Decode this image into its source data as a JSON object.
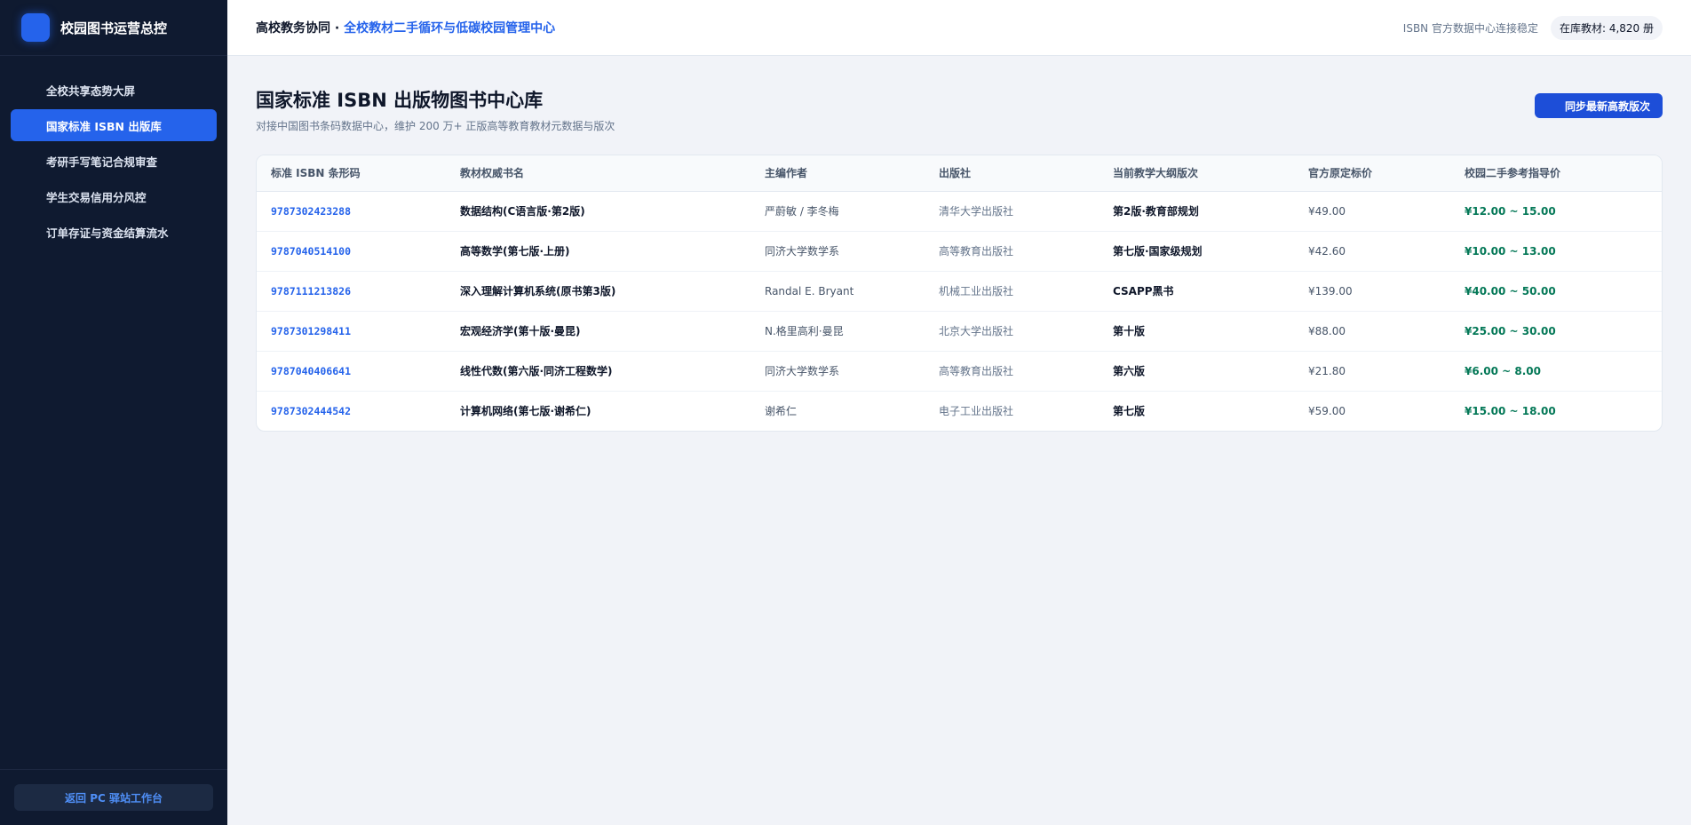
{
  "sidebar": {
    "brand": "校园图书运营总控",
    "items": [
      {
        "label": "全校共享态势大屏"
      },
      {
        "label": "国家标准 ISBN 出版库"
      },
      {
        "label": "考研手写笔记合规审查"
      },
      {
        "label": "学生交易信用分风控"
      },
      {
        "label": "订单存证与资金结算流水"
      }
    ],
    "back_label": "返回 PC 驿站工作台"
  },
  "topbar": {
    "prefix": "高校教务协同 · ",
    "title": "全校教材二手循环与低碳校园管理中心",
    "status": "ISBN 官方数据中心连接稳定",
    "stock": "在库教材: 4,820 册"
  },
  "page": {
    "title": "国家标准 ISBN 出版物图书中心库",
    "subtitle": "对接中国图书条码数据中心，维护 200 万+ 正版高等教育教材元数据与版次",
    "sync_label": "同步最新高教版次"
  },
  "table": {
    "headers": [
      "标准 ISBN 条形码",
      "教材权威书名",
      "主编作者",
      "出版社",
      "当前教学大纲版次",
      "官方原定标价",
      "校园二手参考指导价"
    ],
    "rows": [
      {
        "isbn": "9787302423288",
        "title": "数据结构(C语言版·第2版)",
        "author": "严蔚敏 / 李冬梅",
        "publisher": "清华大学出版社",
        "edition": "第2版·教育部规划",
        "price": "¥49.00",
        "guide": "¥12.00 ~ 15.00"
      },
      {
        "isbn": "9787040514100",
        "title": "高等数学(第七版·上册)",
        "author": "同济大学数学系",
        "publisher": "高等教育出版社",
        "edition": "第七版·国家级规划",
        "price": "¥42.60",
        "guide": "¥10.00 ~ 13.00"
      },
      {
        "isbn": "9787111213826",
        "title": "深入理解计算机系统(原书第3版)",
        "author": "Randal E. Bryant",
        "publisher": "机械工业出版社",
        "edition": "CSAPP黑书",
        "price": "¥139.00",
        "guide": "¥40.00 ~ 50.00"
      },
      {
        "isbn": "9787301298411",
        "title": "宏观经济学(第十版·曼昆)",
        "author": "N.格里高利·曼昆",
        "publisher": "北京大学出版社",
        "edition": "第十版",
        "price": "¥88.00",
        "guide": "¥25.00 ~ 30.00"
      },
      {
        "isbn": "9787040406641",
        "title": "线性代数(第六版·同济工程数学)",
        "author": "同济大学数学系",
        "publisher": "高等教育出版社",
        "edition": "第六版",
        "price": "¥21.80",
        "guide": "¥6.00 ~ 8.00"
      },
      {
        "isbn": "9787302444542",
        "title": "计算机网络(第七版·谢希仁)",
        "author": "谢希仁",
        "publisher": "电子工业出版社",
        "edition": "第七版",
        "price": "¥59.00",
        "guide": "¥15.00 ~ 18.00"
      }
    ]
  },
  "colors": {
    "accent": "#2563eb",
    "sidebar_bg": "#0f1a30",
    "guide_price": "#047857"
  }
}
